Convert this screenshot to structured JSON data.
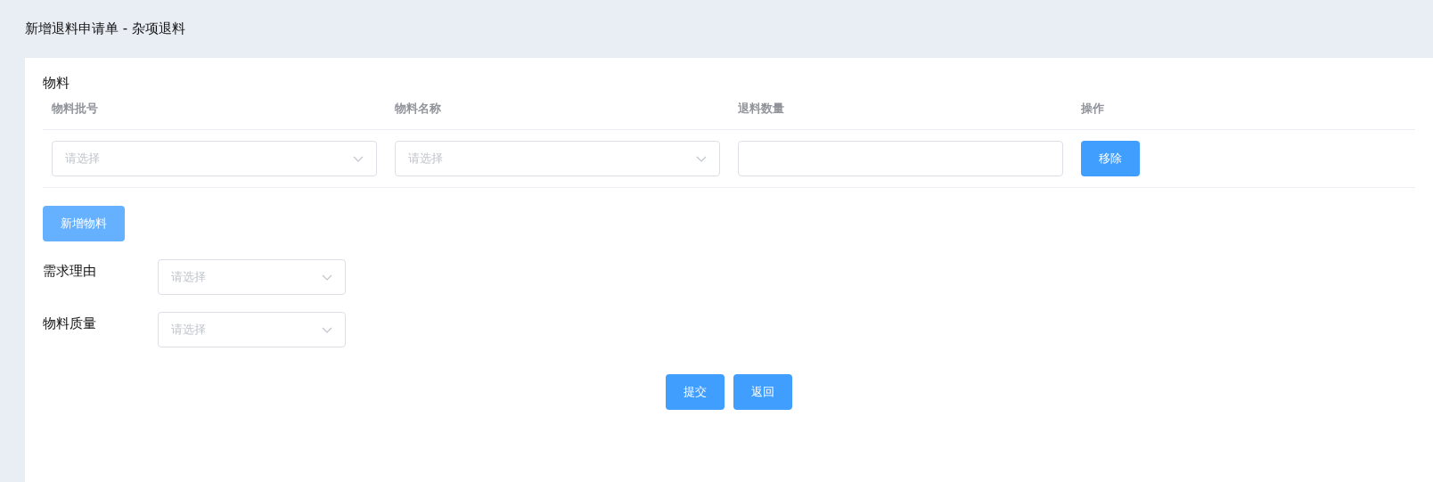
{
  "page_title": "新增退料申请单 - 杂项退料",
  "section_title": "物料",
  "table": {
    "columns": [
      "物料批号",
      "物料名称",
      "退料数量",
      "操作"
    ],
    "rows": [
      {
        "cells": [
          {
            "kind": "select",
            "placeholder": "请选择"
          },
          {
            "kind": "select",
            "placeholder": "请选择"
          },
          {
            "kind": "input"
          },
          {
            "kind": "button",
            "label": "移除"
          }
        ]
      }
    ]
  },
  "add_button": "新增物料",
  "fields": [
    {
      "label": "需求理由",
      "placeholder": "请选择"
    },
    {
      "label": "物料质量",
      "placeholder": "请选择"
    }
  ],
  "buttons": [
    "提交",
    "返回"
  ]
}
